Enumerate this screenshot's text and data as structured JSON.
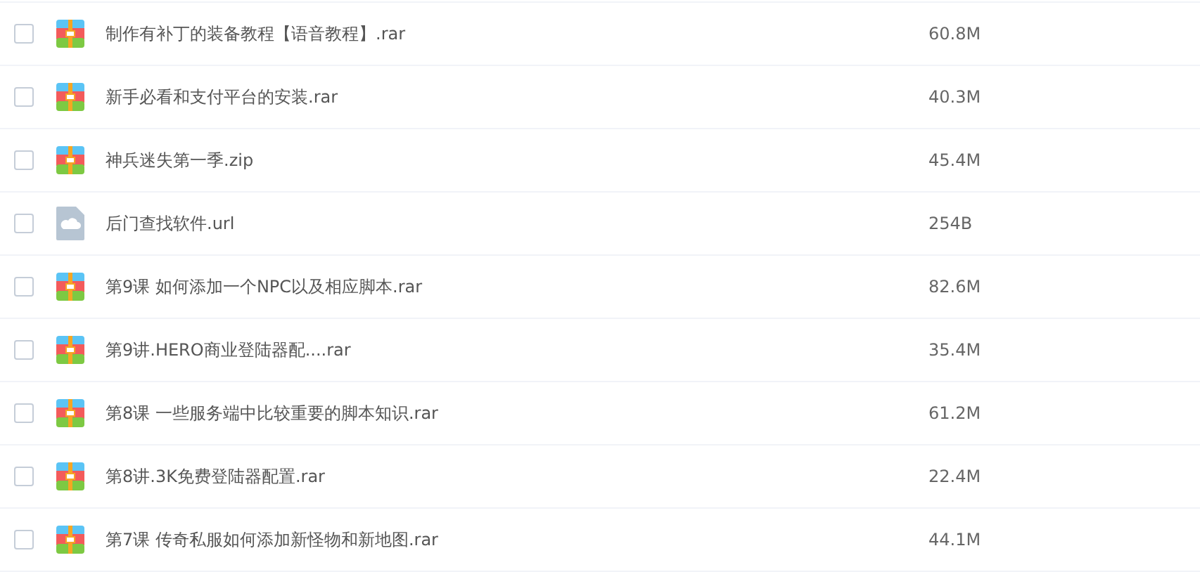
{
  "files": [
    {
      "name": "制作有补丁的装备教程【语音教程】.rar",
      "size": "60.8M",
      "kind": "archive",
      "checked": false
    },
    {
      "name": "新手必看和支付平台的安装.rar",
      "size": "40.3M",
      "kind": "archive",
      "checked": false
    },
    {
      "name": "神兵迷失第一季.zip",
      "size": "45.4M",
      "kind": "archive",
      "checked": false
    },
    {
      "name": "后门查找软件.url",
      "size": "254B",
      "kind": "link",
      "checked": false
    },
    {
      "name": "第9课 如何添加一个NPC以及相应脚本.rar",
      "size": "82.6M",
      "kind": "archive",
      "checked": false
    },
    {
      "name": "第9讲.HERO商业登陆器配....rar",
      "size": "35.4M",
      "kind": "archive",
      "checked": false
    },
    {
      "name": "第8课 一些服务端中比较重要的脚本知识.rar",
      "size": "61.2M",
      "kind": "archive",
      "checked": false
    },
    {
      "name": "第8讲.3K免费登陆器配置.rar",
      "size": "22.4M",
      "kind": "archive",
      "checked": false
    },
    {
      "name": "第7课 传奇私服如何添加新怪物和新地图.rar",
      "size": "44.1M",
      "kind": "archive",
      "checked": false
    }
  ]
}
